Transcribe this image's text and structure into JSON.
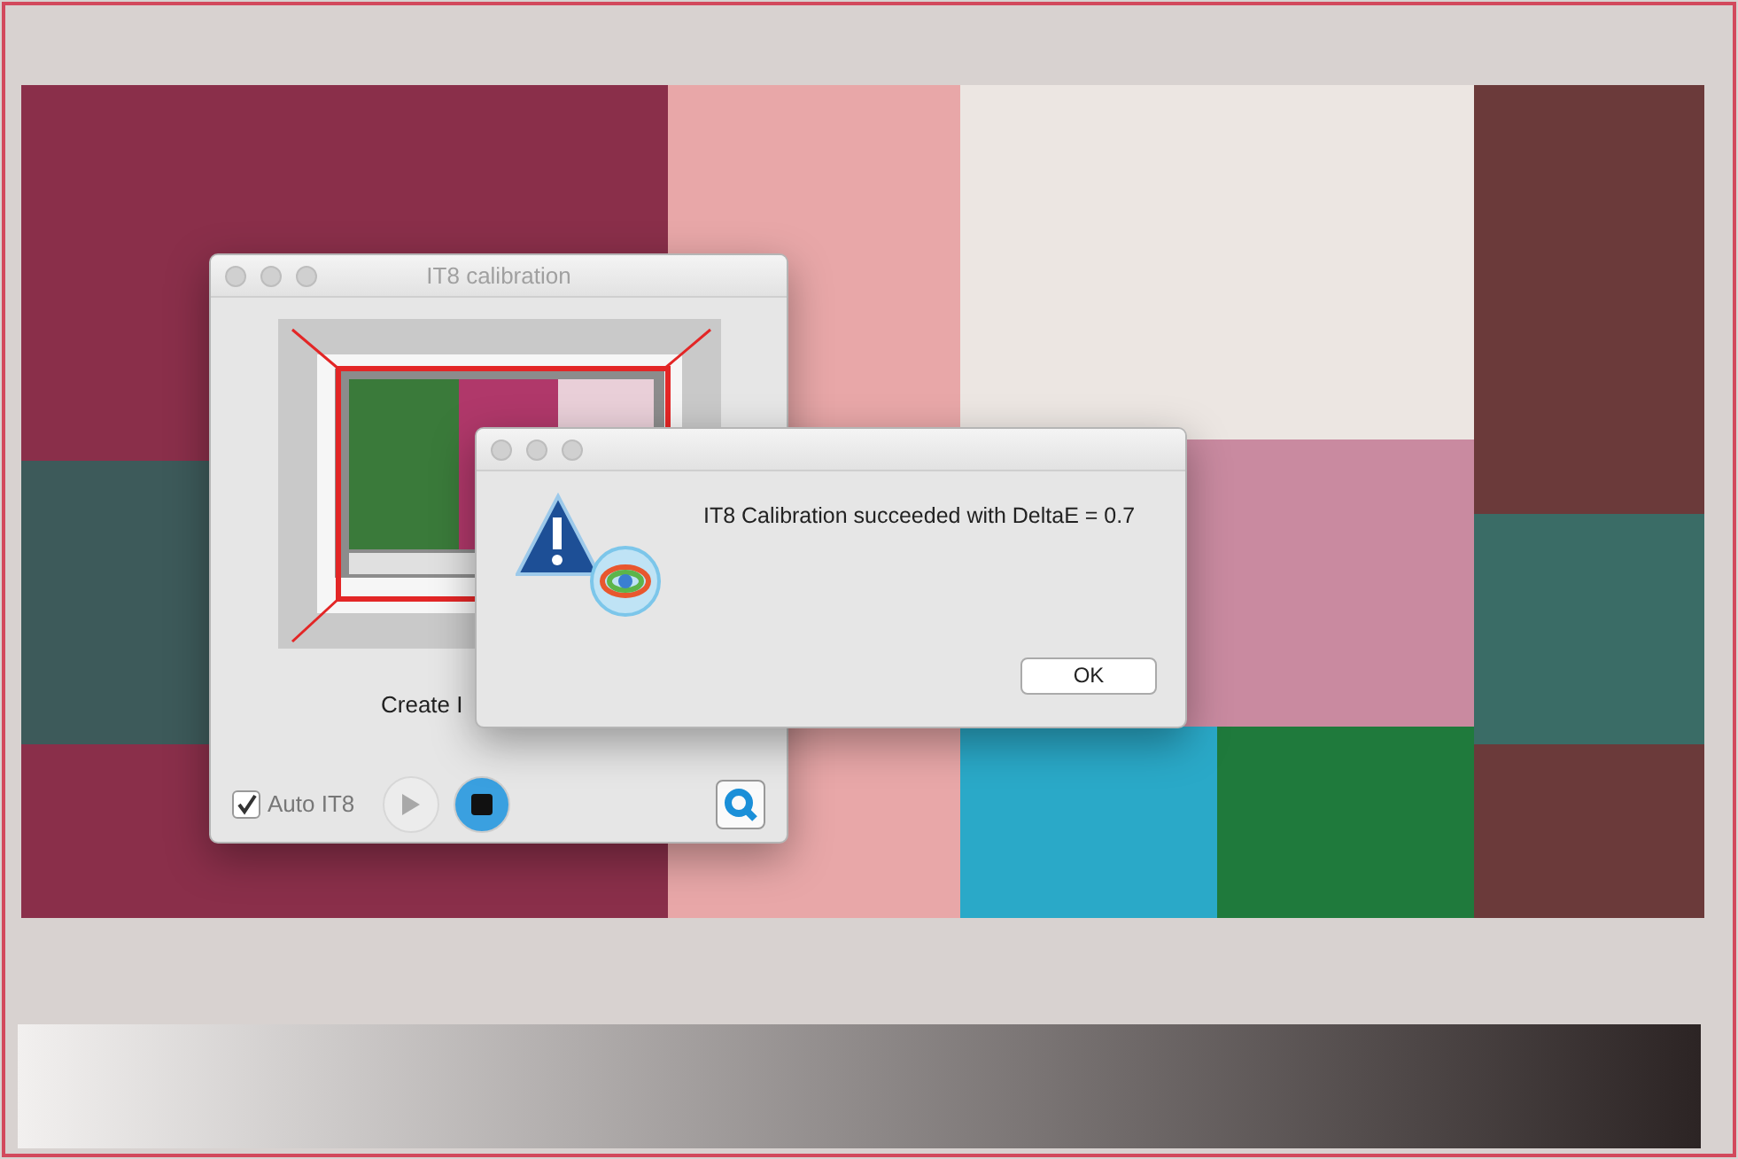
{
  "calibration_window": {
    "title": "IT8 calibration",
    "caption": "Create I",
    "auto_it8": {
      "label": "Auto IT8",
      "checked": true
    },
    "play_button": {
      "disabled": true
    },
    "stop_button": {
      "disabled": false
    }
  },
  "alert": {
    "message": "IT8 Calibration succeeded with DeltaE = 0.7",
    "button": "OK"
  }
}
